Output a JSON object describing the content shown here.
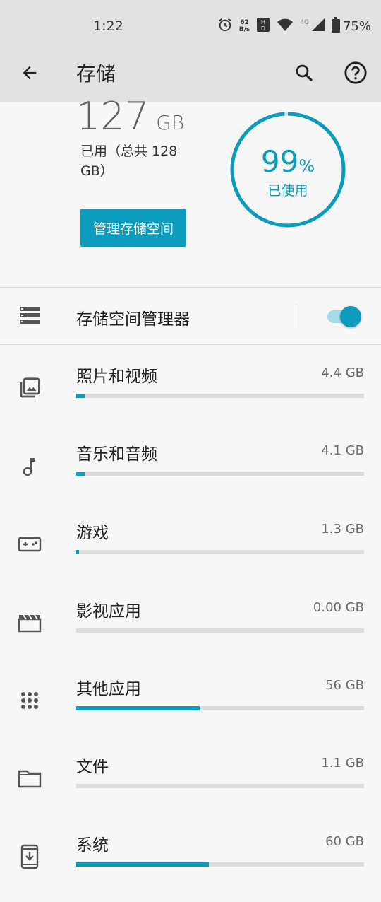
{
  "status_bar": {
    "time": "1:22",
    "net_speed_value": "62",
    "net_speed_unit": "B/s",
    "network_type": "4G",
    "battery": "75%"
  },
  "app_bar": {
    "title": "存储"
  },
  "summary": {
    "used_value": "127",
    "used_unit": "GB",
    "total_text": "已用（总共 128 GB）",
    "manage_button": "管理存储空间",
    "ring_percent": "99",
    "ring_percent_sign": "%",
    "ring_label": "已使用",
    "ring_fraction": 0.99
  },
  "storage_manager": {
    "label": "存储空间管理器",
    "enabled": true
  },
  "categories": [
    {
      "label": "照片和视频",
      "size": "4.4 GB",
      "fraction": 0.03,
      "icon": "photos-icon"
    },
    {
      "label": "音乐和音频",
      "size": "4.1 GB",
      "fraction": 0.03,
      "icon": "music-note-icon"
    },
    {
      "label": "游戏",
      "size": "1.3 GB",
      "fraction": 0.01,
      "icon": "gamepad-icon"
    },
    {
      "label": "影视应用",
      "size": "0.00 GB",
      "fraction": 0.0,
      "icon": "movie-icon"
    },
    {
      "label": "其他应用",
      "size": "56 GB",
      "fraction": 0.43,
      "icon": "apps-grid-icon"
    },
    {
      "label": "文件",
      "size": "1.1 GB",
      "fraction": 0.0,
      "icon": "folder-icon"
    },
    {
      "label": "系统",
      "size": "60 GB",
      "fraction": 0.46,
      "icon": "system-update-icon"
    }
  ],
  "colors": {
    "accent": "#0a9bbd",
    "track": "#dcdcdc",
    "header_bg": "#e2e2e2"
  }
}
